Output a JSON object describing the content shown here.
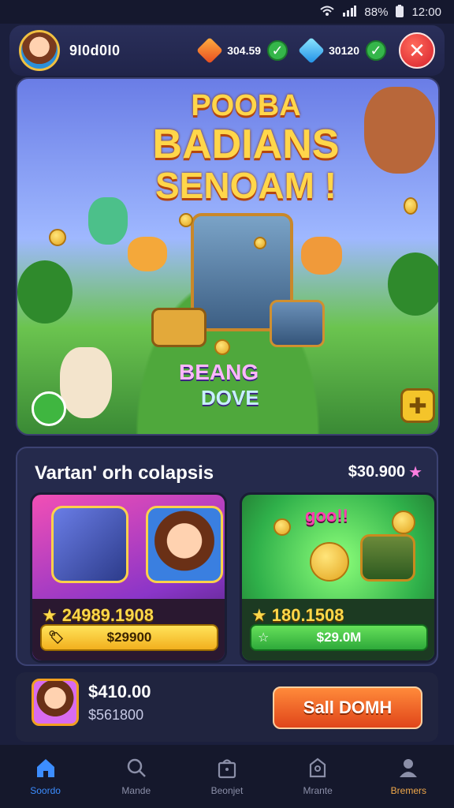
{
  "status_bar": {
    "battery": "88%",
    "time": "12:00"
  },
  "header": {
    "username": "9I0d0I0",
    "currency_1": "304.59",
    "currency_2": "30120"
  },
  "banner": {
    "title_line_1": "POOBA",
    "title_line_2": "BADIANS",
    "title_line_3": "SENOAM !",
    "tagline_line_1": "BEANG",
    "tagline_line_2": "DOVE"
  },
  "offers": {
    "title": "Vartan' orh colapsis",
    "price": "$30.900",
    "cards": [
      {
        "value": "24989.1908",
        "button_label": "$29900"
      },
      {
        "banner_text": "goo!!",
        "value": "180.1508",
        "button_label": "$29.0M"
      }
    ]
  },
  "purchase": {
    "price": "$410.00",
    "subtext": "$561800",
    "button_label": "Sall DOMH"
  },
  "nav": {
    "items": [
      {
        "label": "Soordo",
        "icon": "home-icon"
      },
      {
        "label": "Mande",
        "icon": "search-icon"
      },
      {
        "label": "Beonjet",
        "icon": "store-icon"
      },
      {
        "label": "Mrante",
        "icon": "chest-icon"
      },
      {
        "label": "Bremers",
        "icon": "profile-icon"
      }
    ]
  },
  "colors": {
    "accent": "#3c8dff",
    "gold": "#ffd84a",
    "close": "#d61f2b",
    "buy_button": "#e0451a"
  }
}
